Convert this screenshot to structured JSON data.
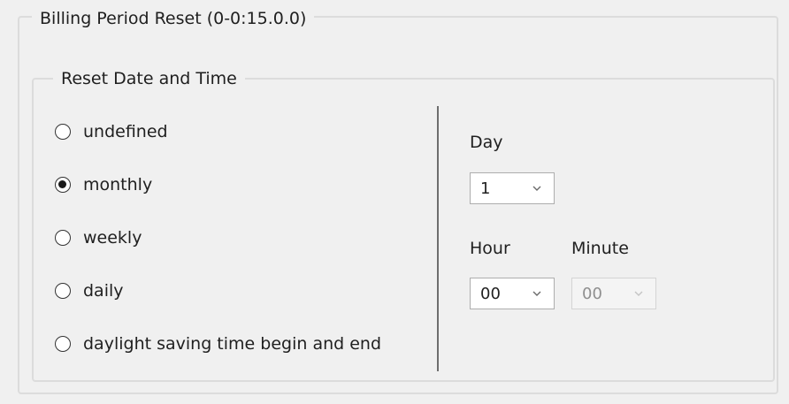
{
  "groups": {
    "outer_title": "Billing Period Reset (0-0:15.0.0)",
    "inner_title": "Reset Date and Time"
  },
  "reset_options": [
    {
      "label": "undefined",
      "checked": false
    },
    {
      "label": "monthly",
      "checked": true
    },
    {
      "label": "weekly",
      "checked": false
    },
    {
      "label": "daily",
      "checked": false
    },
    {
      "label": "daylight saving time begin and end",
      "checked": false
    }
  ],
  "day": {
    "label": "Day",
    "value": "1",
    "enabled": true
  },
  "hour": {
    "label": "Hour",
    "value": "00",
    "enabled": true
  },
  "minute": {
    "label": "Minute",
    "value": "00",
    "enabled": false
  },
  "icons": {
    "dropdown": "chevron-down-icon",
    "radio": "radio-circle-icon"
  }
}
